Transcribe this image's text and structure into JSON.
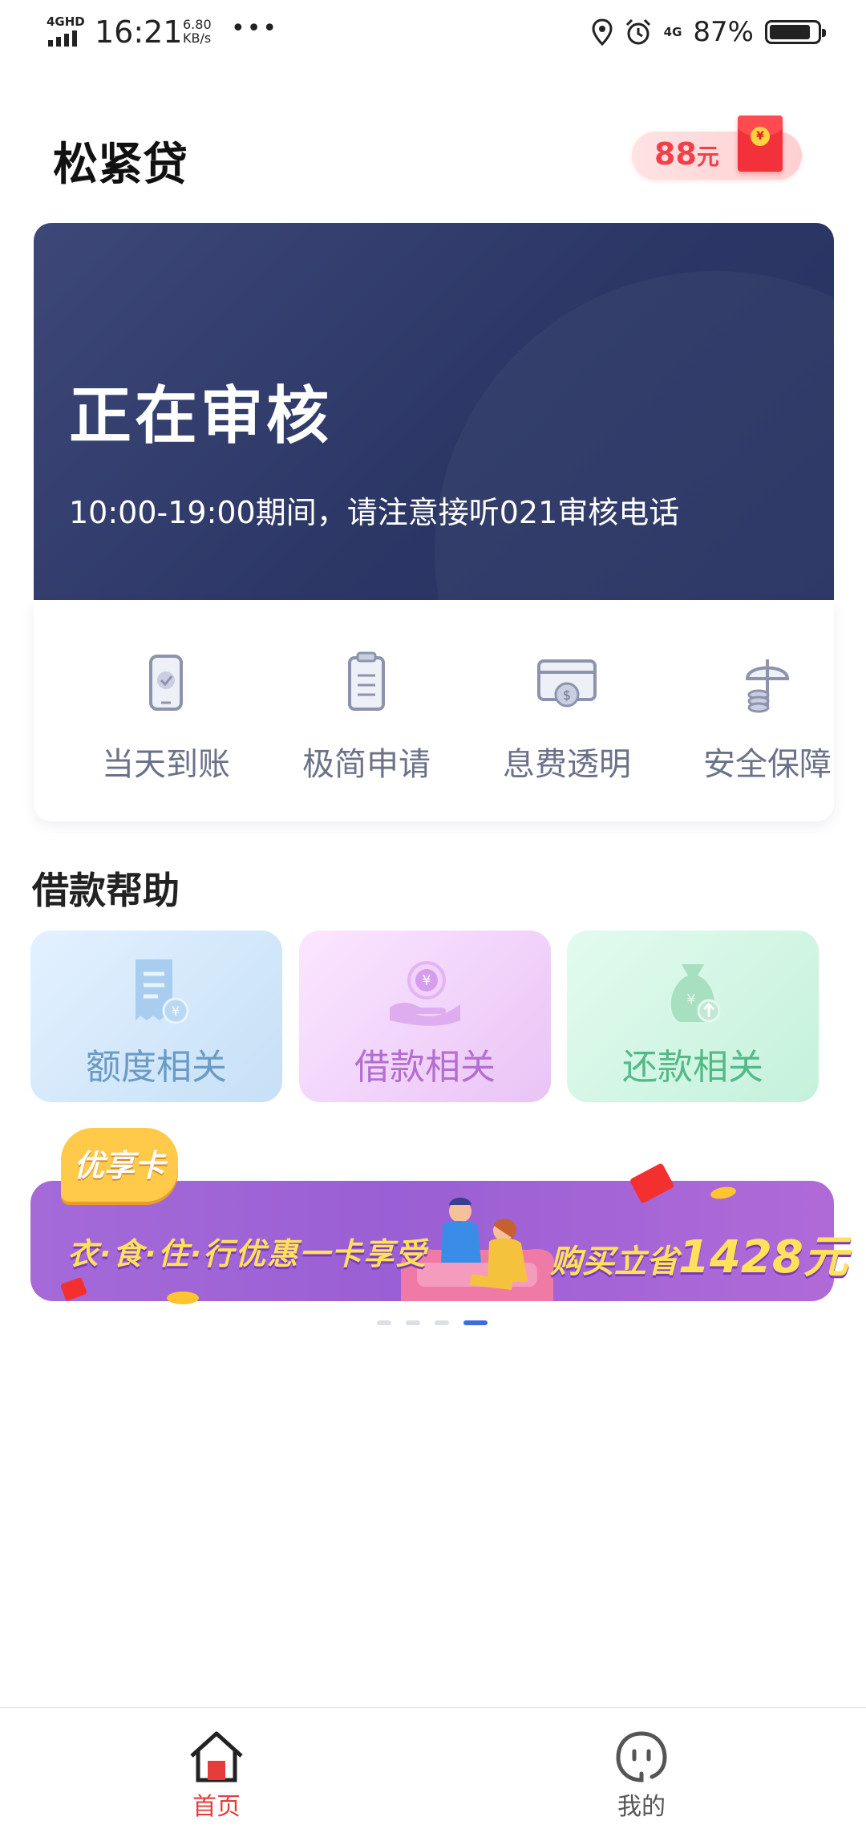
{
  "status_bar": {
    "network": "4GHD",
    "time": "16:21",
    "speed_value": "6.80",
    "speed_unit": "KB/s",
    "more": "•••",
    "network_right": "4G",
    "battery_percent": "87%",
    "battery_level": 0.87
  },
  "header": {
    "title": "松紧贷",
    "coupon_amount": "88",
    "coupon_unit": "元",
    "coupon_seal": "¥"
  },
  "review": {
    "title": "正在审核",
    "note": "10:00-19:00期间，请注意接听021审核电话"
  },
  "features": [
    {
      "label": "当天到账",
      "icon": "phone-check-icon"
    },
    {
      "label": "极简申请",
      "icon": "clipboard-icon"
    },
    {
      "label": "息费透明",
      "icon": "card-dollar-icon"
    },
    {
      "label": "安全保障",
      "icon": "umbrella-coins-icon"
    }
  ],
  "help": {
    "title": "借款帮助",
    "cards": [
      {
        "label": "额度相关",
        "icon": "receipt-yen-icon"
      },
      {
        "label": "借款相关",
        "icon": "hand-yen-icon"
      },
      {
        "label": "还款相关",
        "icon": "money-bag-icon"
      }
    ]
  },
  "promo": {
    "badge": "优享卡",
    "left_text": "衣·食·住·行优惠一卡享受",
    "right_prefix": "购买立省",
    "right_amount": "1428元"
  },
  "pager": {
    "count": 4,
    "active": 4
  },
  "nav": {
    "home_label": "首页",
    "mine_label": "我的"
  },
  "colors": {
    "banner": "#2c3766",
    "accent_red": "#e63c3c",
    "pager_active": "#3f6bde"
  }
}
